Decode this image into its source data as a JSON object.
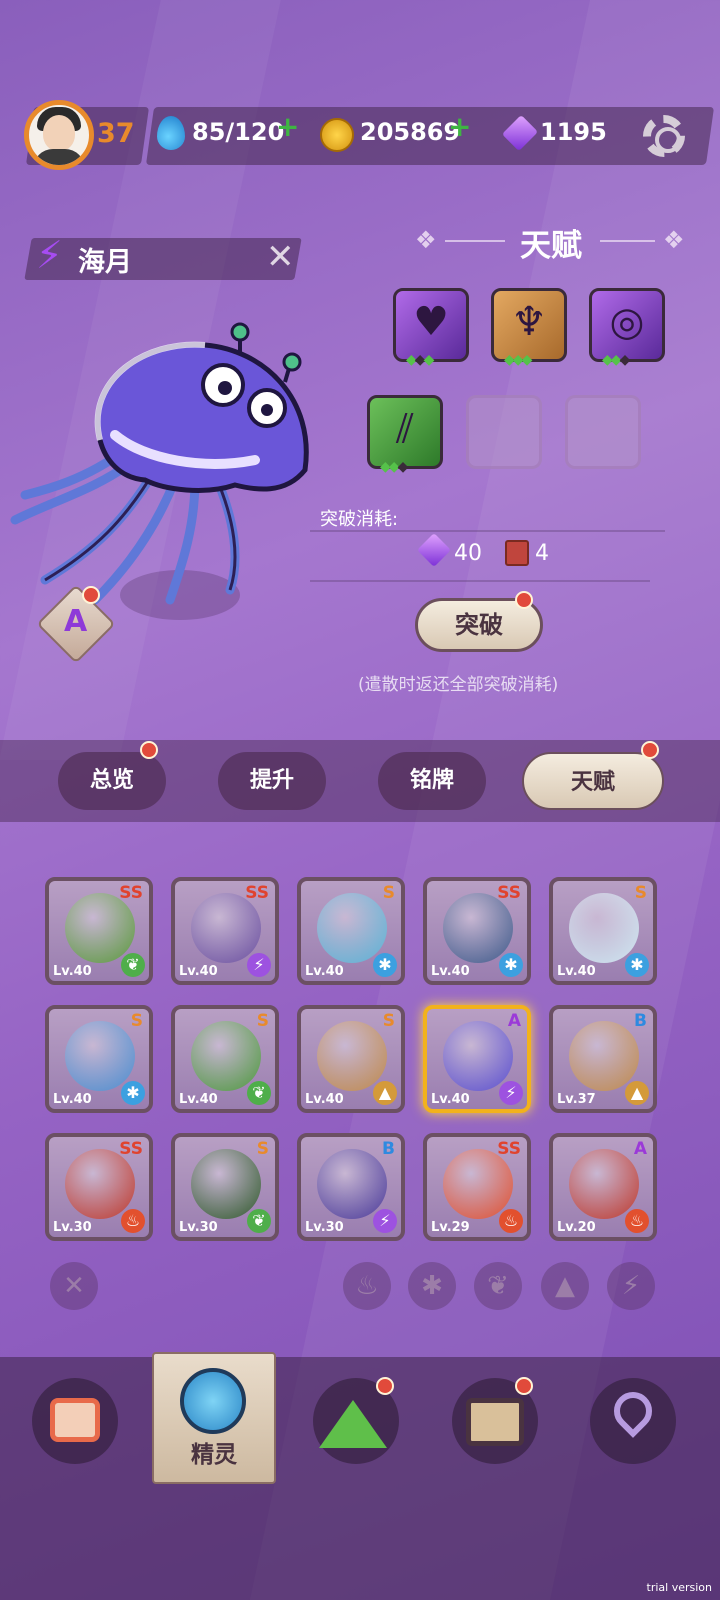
{
  "player": {
    "level": "37"
  },
  "resources": {
    "stamina": "85/120",
    "coins": "205869",
    "gems": "1195"
  },
  "pet": {
    "name": "海月",
    "grade": "A"
  },
  "talent": {
    "title": "天赋",
    "icons": [
      {
        "name": "purple-heart-talent",
        "pips": [
          true,
          false,
          true
        ]
      },
      {
        "name": "gold-wing-talent",
        "pips": [
          true,
          true,
          true
        ]
      },
      {
        "name": "purple-swirl-talent",
        "pips": [
          true,
          true,
          false
        ]
      },
      {
        "name": "green-claw-talent",
        "pips": [
          true,
          true,
          false
        ]
      }
    ],
    "cost_label": "突破消耗:",
    "cost_gem": "40",
    "cost_book": "4",
    "break_button": "突破",
    "hint": "(遣散时返还全部突破消耗)"
  },
  "tabs": [
    "总览",
    "提升",
    "铭牌",
    "天赋"
  ],
  "pets": [
    {
      "grade": "SS",
      "level": "Lv.40",
      "element": "leaf",
      "art": "#5a9b3a"
    },
    {
      "grade": "SS",
      "level": "Lv.40",
      "element": "bolt",
      "art": "#6a4fa0"
    },
    {
      "grade": "S",
      "level": "Lv.40",
      "element": "snow",
      "art": "#5ab4d6"
    },
    {
      "grade": "SS",
      "level": "Lv.40",
      "element": "snow",
      "art": "#3d5a8a"
    },
    {
      "grade": "S",
      "level": "Lv.40",
      "element": "snow",
      "art": "#cfe8f2"
    },
    {
      "grade": "S",
      "level": "Lv.40",
      "element": "snow",
      "art": "#4a8ed0"
    },
    {
      "grade": "S",
      "level": "Lv.40",
      "element": "leaf",
      "art": "#4d9a3c"
    },
    {
      "grade": "S",
      "level": "Lv.40",
      "element": "rock",
      "art": "#c08a4a"
    },
    {
      "grade": "A",
      "level": "Lv.40",
      "element": "bolt",
      "art": "#5a4fd0"
    },
    {
      "grade": "B",
      "level": "Lv.37",
      "element": "rock",
      "art": "#c08a4a"
    },
    {
      "grade": "SS",
      "level": "Lv.30",
      "element": "fire",
      "art": "#c0392b"
    },
    {
      "grade": "S",
      "level": "Lv.30",
      "element": "leaf",
      "art": "#2f5a2a"
    },
    {
      "grade": "B",
      "level": "Lv.30",
      "element": "bolt",
      "art": "#4a3a9a"
    },
    {
      "grade": "SS",
      "level": "Lv.29",
      "element": "fire",
      "art": "#e2502e"
    },
    {
      "grade": "A",
      "level": "Lv.20",
      "element": "fire",
      "art": "#c0392b"
    }
  ],
  "selected_pet_index": 8,
  "nav": {
    "active_label": "精灵"
  },
  "watermark": "trial version"
}
